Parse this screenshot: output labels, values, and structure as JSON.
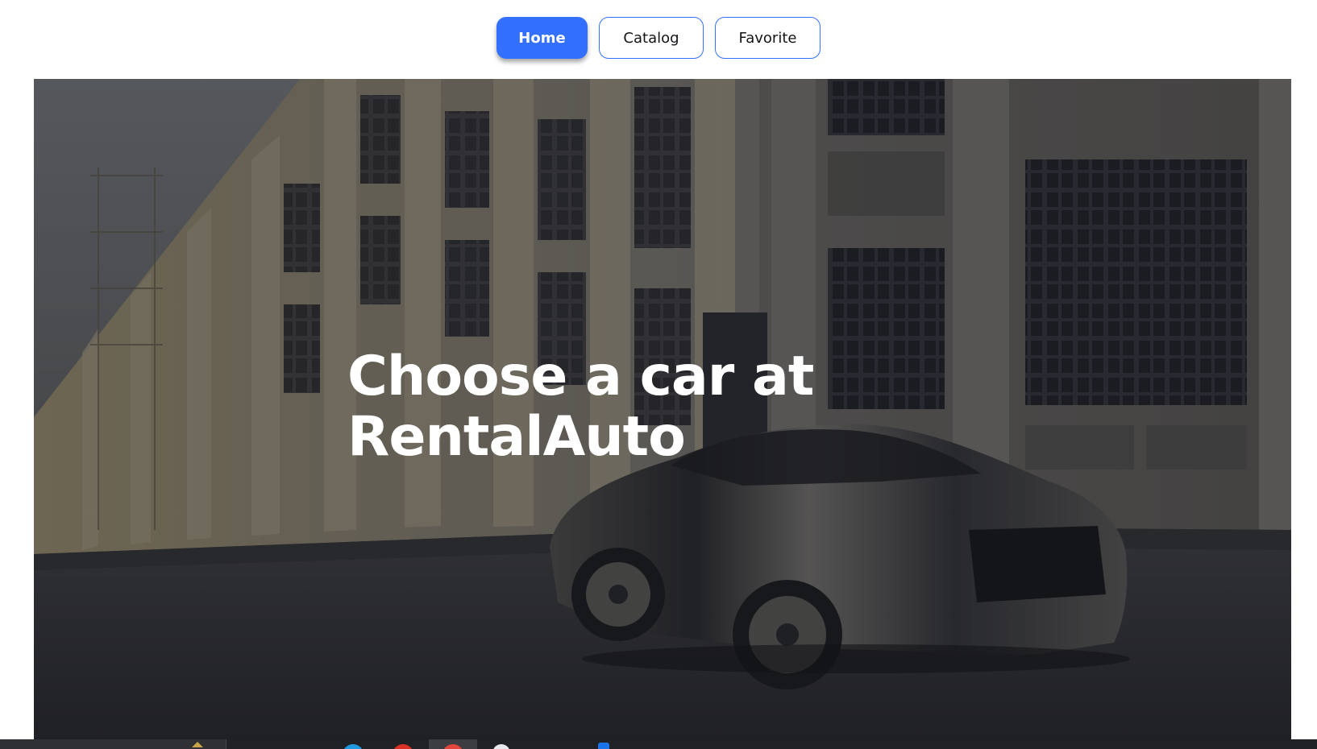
{
  "nav": {
    "home_label": "Home",
    "catalog_label": "Catalog",
    "favorite_label": "Favorite",
    "active": "Home"
  },
  "hero": {
    "title": "Choose a car at\nRentalAuto",
    "background_icon": "car-street-photo"
  },
  "colors": {
    "accent": "#3470ff",
    "text_dark": "#121417",
    "text_light": "#ffffff"
  },
  "taskbar": {
    "icons": [
      "search-box",
      "folder-icon",
      "app-icon-blue",
      "app-icon-red",
      "app-icon-red-active",
      "app-icon-white",
      "app-icon-blue-edge"
    ]
  }
}
